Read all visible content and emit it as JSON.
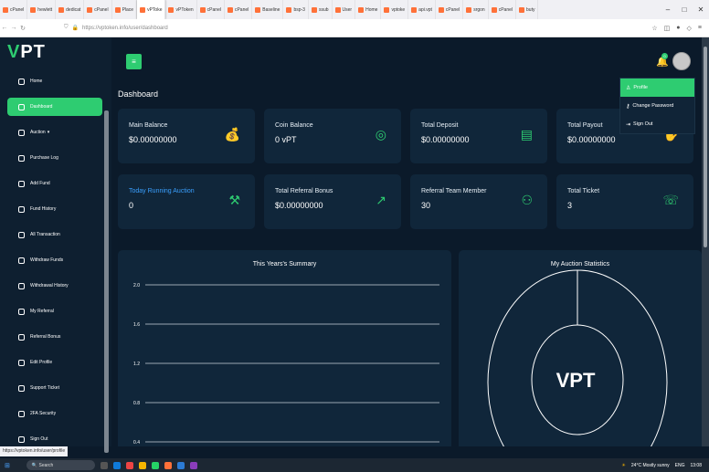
{
  "browser": {
    "tabs": [
      "cPanel",
      "hewlett",
      "dedicat",
      "cPanel",
      "Place",
      "vPToke",
      "vPToken",
      "cPanel",
      "cPanel",
      "Baseline",
      "bsp-3",
      "ssub",
      "User",
      "Home",
      "vptoke",
      "api.vpt",
      "cPanel",
      "srgon",
      "cPanel",
      "buty"
    ],
    "active_tab_index": 5,
    "url": "https://vptoken.info/user/dashboard",
    "status_url": "https://vptoken.info/user/profile"
  },
  "taskbar": {
    "search": "Search",
    "weather": "24°C Mostly sunny",
    "lang": "ENG",
    "time": "13:08"
  },
  "app": {
    "logo": "VPT",
    "logo_v": "V",
    "logo_rest": "PT",
    "page_title": "Dashboard",
    "notification_count": "0",
    "accent": "#2ecc71"
  },
  "sidebar": {
    "items": [
      {
        "label": "Home",
        "icon": "home-icon"
      },
      {
        "label": "Dashboard",
        "icon": "dashboard-icon",
        "active": true
      },
      {
        "label": "Auction",
        "icon": "auction-icon",
        "caret": true
      },
      {
        "label": "Purchase Log",
        "icon": "cart-icon"
      },
      {
        "label": "Add Fund",
        "icon": "plus-icon"
      },
      {
        "label": "Fund History",
        "icon": "history-icon"
      },
      {
        "label": "All Transaction",
        "icon": "exchange-icon"
      },
      {
        "label": "Withdraw Funds",
        "icon": "withdraw-icon"
      },
      {
        "label": "Withdrawal History",
        "icon": "history-icon"
      },
      {
        "label": "My Referral",
        "icon": "referral-icon"
      },
      {
        "label": "Referral Bonus",
        "icon": "gift-icon"
      },
      {
        "label": "Edit Profile",
        "icon": "edit-icon"
      },
      {
        "label": "Support Ticket",
        "icon": "ticket-icon"
      },
      {
        "label": "2FA Security",
        "icon": "shield-icon"
      },
      {
        "label": "Sign Out",
        "icon": "logout-icon"
      }
    ]
  },
  "dropdown": [
    {
      "label": "Profile",
      "icon": "user-icon",
      "active": true
    },
    {
      "label": "Change Password",
      "icon": "key-icon"
    },
    {
      "label": "Sign Out",
      "icon": "logout-icon"
    }
  ],
  "cards": [
    {
      "label": "Main Balance",
      "value": "$0.00000000",
      "icon": "money-bag-icon"
    },
    {
      "label": "Coin Balance",
      "value": "0 vPT",
      "icon": "coins-icon"
    },
    {
      "label": "Total Deposit",
      "value": "$0.00000000",
      "icon": "invoice-icon"
    },
    {
      "label": "Total Payout",
      "value": "$0.00000000",
      "icon": "hand-money-icon"
    },
    {
      "label": "Today Running Auction",
      "value": "0",
      "icon": "gavel-icon",
      "highlight": true
    },
    {
      "label": "Total Referral Bonus",
      "value": "$0.00000000",
      "icon": "share-icon"
    },
    {
      "label": "Referral Team Member",
      "value": "30",
      "icon": "team-icon"
    },
    {
      "label": "Total Ticket",
      "value": "3",
      "icon": "support-icon"
    }
  ],
  "summary": {
    "title": "This Years's Summary",
    "ticks": [
      "2.0",
      "1.6",
      "1.2",
      "0.8",
      "0.4"
    ]
  },
  "auction_stats": {
    "title": "My Auction Statistics",
    "center_logo": "VPT"
  }
}
